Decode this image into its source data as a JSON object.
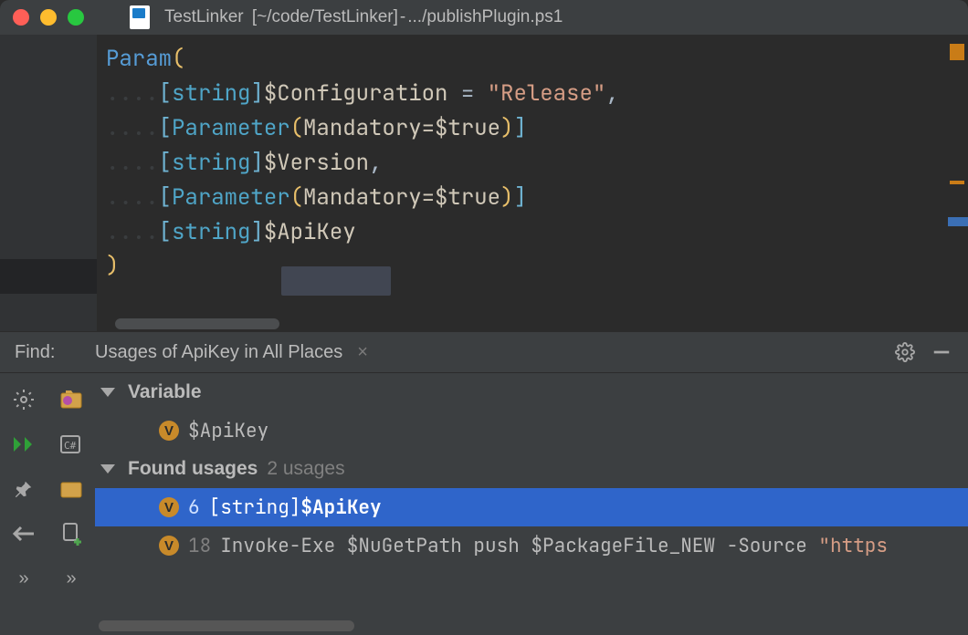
{
  "titlebar": {
    "project": "TestLinker",
    "path": "[~/code/TestLinker]",
    "sep": " - ",
    "file": ".../publishPlugin.ps1"
  },
  "code": {
    "l1_kw": "Param",
    "l1_open": "(",
    "ws4": "....",
    "lbrack": "[",
    "rbrack": "]",
    "type_string": "string",
    "var_config": "$Configuration",
    "eq": " = ",
    "str_release": "\"Release\"",
    "comma": ",",
    "type_param": "Parameter",
    "paren_open": "(",
    "mand": "Mandatory=",
    "true": "$true",
    "paren_close": ")",
    "var_version": "$Version",
    "var_apikey": "$ApiKey",
    "close": ")"
  },
  "find": {
    "label": "Find:",
    "desc": "Usages of ApiKey in All Places",
    "close": "×"
  },
  "results": {
    "h1": "Variable",
    "r1": "$ApiKey",
    "h2a": "Found usages",
    "h2b": "2 usages",
    "row_sel_line": "6",
    "row_sel_prefix": " [string]",
    "row_sel_bold": "$ApiKey",
    "row2_line": "18",
    "row2_text": " Invoke-Exe $NuGetPath push $PackageFile_NEW -Source ",
    "row2_str": "\"https"
  },
  "icons": {
    "more": "»"
  }
}
